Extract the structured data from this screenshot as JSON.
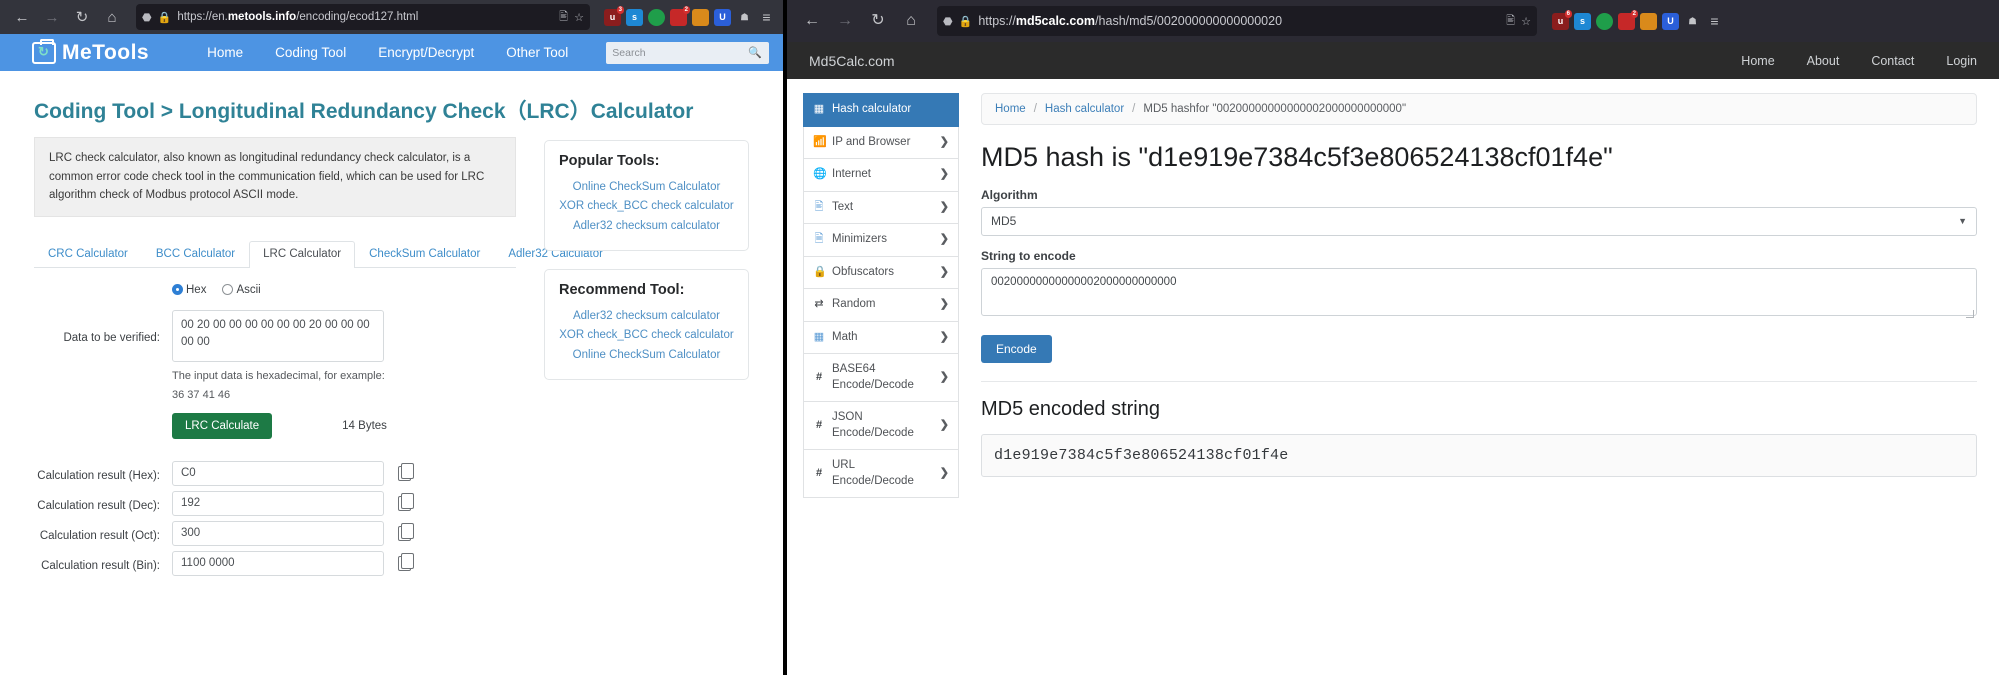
{
  "left_window": {
    "browser": {
      "back_icon": "arrow-left-icon",
      "forward_icon": "arrow-right-icon",
      "reload_icon": "reload-icon",
      "home_icon": "home-icon",
      "shield_icon": "shield-icon",
      "lock_icon": "lock-icon",
      "url_prefix": "https://en.",
      "url_domain": "metools.info",
      "url_suffix": "/encoding/ecod127.html",
      "reader_icon": "reader-view-icon",
      "bookmark_icon": "star-icon",
      "extensions": [
        {
          "name": "ublock-origin-icon",
          "glyph": "u",
          "color": "#8b1d1d",
          "badge": "3"
        },
        {
          "name": "sync-icon",
          "glyph": "s",
          "color": "#1e88d4",
          "badge": ""
        },
        {
          "name": "shield-green-icon",
          "glyph": "",
          "color": "#1f9e4a",
          "badge": ""
        },
        {
          "name": "alert-icon",
          "glyph": "",
          "color": "#c62828",
          "badge": "2"
        },
        {
          "name": "pencil-icon",
          "glyph": "",
          "color": "#d98a1b",
          "badge": ""
        },
        {
          "name": "bitwarden-icon",
          "glyph": "U",
          "color": "#2b5fd9",
          "badge": ""
        },
        {
          "name": "extension-icon",
          "glyph": "",
          "color": "#4a4b52",
          "badge": ""
        },
        {
          "name": "menu-icon",
          "glyph": "≡",
          "color": "#33343c",
          "badge": ""
        }
      ]
    },
    "site_nav": {
      "logo_text": "MeTools",
      "logo_icon": "toolbox-refresh-icon",
      "links": [
        "Home",
        "Coding Tool",
        "Encrypt/Decrypt",
        "Other Tool"
      ],
      "search_placeholder": "Search",
      "search_icon": "search-icon"
    },
    "page": {
      "breadcrumb": "Coding Tool",
      "breadcrumb_sep": " > ",
      "title": "Longitudinal Redundancy Check（LRC）Calculator",
      "description": "LRC check calculator, also known as longitudinal redundancy check calculator, is a common error code check tool in the communication field, which can be used for LRC algorithm check of Modbus protocol ASCII mode.",
      "tabs": [
        {
          "label": "CRC Calculator",
          "active": false
        },
        {
          "label": "BCC Calculator",
          "active": false
        },
        {
          "label": "LRC Calculator",
          "active": true
        },
        {
          "label": "CheckSum Calculator",
          "active": false
        },
        {
          "label": "Adler32 Calculator",
          "active": false
        }
      ],
      "form": {
        "radio_hex": "Hex",
        "radio_ascii": "Ascii",
        "radio_selected": "Hex",
        "data_label": "Data to be verified:",
        "data_value": "00 20 00 00 00 00 00 00 20 00 00 00 00 00",
        "hint_line1": "The input data is hexadecimal, for example:",
        "hint_line2": "36 37 41 46",
        "calculate_button": "LRC Calculate",
        "bytes_text": "14 Bytes",
        "results": [
          {
            "label": "Calculation result (Hex):",
            "value": "C0",
            "copy_icon": "copy-icon"
          },
          {
            "label": "Calculation result (Dec):",
            "value": "192",
            "copy_icon": "copy-icon"
          },
          {
            "label": "Calculation result (Oct):",
            "value": "300",
            "copy_icon": "copy-icon"
          },
          {
            "label": "Calculation result (Bin):",
            "value": "1100 0000",
            "copy_icon": "copy-icon"
          }
        ]
      },
      "popular": {
        "title": "Popular Tools:",
        "links": [
          "Online CheckSum Calculator",
          "XOR check_BCC check calculator",
          "Adler32 checksum calculator"
        ]
      },
      "recommend": {
        "title": "Recommend Tool:",
        "links": [
          "Adler32 checksum calculator",
          "XOR check_BCC check calculator",
          "Online CheckSum Calculator"
        ]
      }
    }
  },
  "right_window": {
    "browser": {
      "back_icon": "arrow-left-icon",
      "forward_icon": "arrow-right-icon",
      "reload_icon": "reload-icon",
      "home_icon": "home-icon",
      "shield_icon": "shield-icon",
      "lock_icon": "lock-icon",
      "url_prefix": "https://",
      "url_domain": "md5calc.com",
      "url_suffix": "/hash/md5/002000000000000020",
      "reader_icon": "reader-view-icon",
      "bookmark_icon": "star-icon",
      "extensions": [
        {
          "name": "ublock-origin-icon",
          "glyph": "u",
          "color": "#8b1d1d",
          "badge": "6"
        },
        {
          "name": "sync-icon",
          "glyph": "s",
          "color": "#1e88d4",
          "badge": ""
        },
        {
          "name": "shield-green-icon",
          "glyph": "",
          "color": "#1f9e4a",
          "badge": ""
        },
        {
          "name": "alert-icon",
          "glyph": "",
          "color": "#c62828",
          "badge": "2"
        },
        {
          "name": "pencil-icon",
          "glyph": "",
          "color": "#d98a1b",
          "badge": ""
        },
        {
          "name": "bitwarden-icon",
          "glyph": "U",
          "color": "#2b5fd9",
          "badge": ""
        },
        {
          "name": "extension-icon",
          "glyph": "",
          "color": "#3a3b42",
          "badge": ""
        },
        {
          "name": "menu-icon",
          "glyph": "≡",
          "color": "#2b2a33",
          "badge": ""
        }
      ]
    },
    "site_nav": {
      "brand": "Md5Calc.com",
      "links": [
        "Home",
        "About",
        "Contact",
        "Login"
      ]
    },
    "sidebar": [
      {
        "label": "Hash calculator",
        "icon": "grid-icon",
        "arrow": "",
        "active": true
      },
      {
        "label": "IP and Browser",
        "icon": "wifi-icon",
        "arrow": "❯",
        "active": false
      },
      {
        "label": "Internet",
        "icon": "globe-icon",
        "arrow": "❯",
        "active": false
      },
      {
        "label": "Text",
        "icon": "document-icon",
        "arrow": "❯",
        "active": false
      },
      {
        "label": "Minimizers",
        "icon": "compress-icon",
        "arrow": "❯",
        "active": false
      },
      {
        "label": "Obfuscators",
        "icon": "lock-icon",
        "arrow": "❯",
        "active": false
      },
      {
        "label": "Random",
        "icon": "shuffle-icon",
        "arrow": "❯",
        "active": false
      },
      {
        "label": "Math",
        "icon": "grid-icon",
        "arrow": "❯",
        "active": false
      },
      {
        "label": "BASE64 Encode/Decode",
        "icon": "hash-icon",
        "arrow": "❯",
        "active": false
      },
      {
        "label": "JSON Encode/Decode",
        "icon": "hash-icon",
        "arrow": "❯",
        "active": false
      },
      {
        "label": "URL Encode/Decode",
        "icon": "hash-icon",
        "arrow": "❯",
        "active": false
      }
    ],
    "breadcrumbs": [
      {
        "label": "Home",
        "link": true
      },
      {
        "label": "Hash calculator",
        "link": true
      },
      {
        "label": "MD5 hashfor \"00200000000000002000000000000\"",
        "link": false
      }
    ],
    "heading": "MD5 hash is \"d1e919e7384c5f3e806524138cf01f4e\"",
    "algorithm_label": "Algorithm",
    "algorithm_value": "MD5",
    "string_label": "String to encode",
    "string_value": "00200000000000002000000000000",
    "encode_button": "Encode",
    "output_heading": "MD5 encoded string",
    "output_value": "d1e919e7384c5f3e806524138cf01f4e"
  },
  "colors": {
    "metools_blue": "#4d94e3",
    "metools_teal": "#2f8296",
    "calc_green": "#1d7a45",
    "md5_blue": "#3579b5",
    "link_blue": "#4e8fc4"
  }
}
